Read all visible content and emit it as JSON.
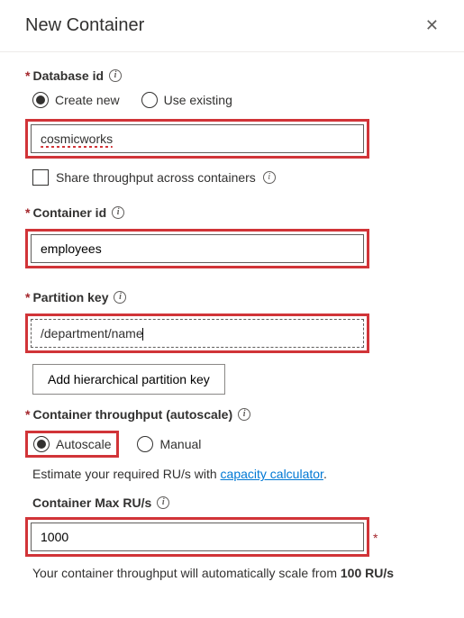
{
  "header": {
    "title": "New Container"
  },
  "database": {
    "label": "Database id",
    "options": {
      "create_new": "Create new",
      "use_existing": "Use existing"
    },
    "value": "cosmicworks",
    "share_label": "Share throughput across containers"
  },
  "container": {
    "label": "Container id",
    "value": "employees"
  },
  "partition": {
    "label": "Partition key",
    "value": "/department/name",
    "hier_button": "Add hierarchical partition key"
  },
  "throughput": {
    "label": "Container throughput (autoscale)",
    "options": {
      "autoscale": "Autoscale",
      "manual": "Manual"
    },
    "estimate_prefix": "Estimate your required RU/s with ",
    "estimate_link": "capacity calculator",
    "max_label": "Container Max RU/s",
    "max_value": "1000",
    "scale_note_prefix": "Your container throughput will automatically scale from ",
    "scale_note_bold": "100 RU/s"
  }
}
